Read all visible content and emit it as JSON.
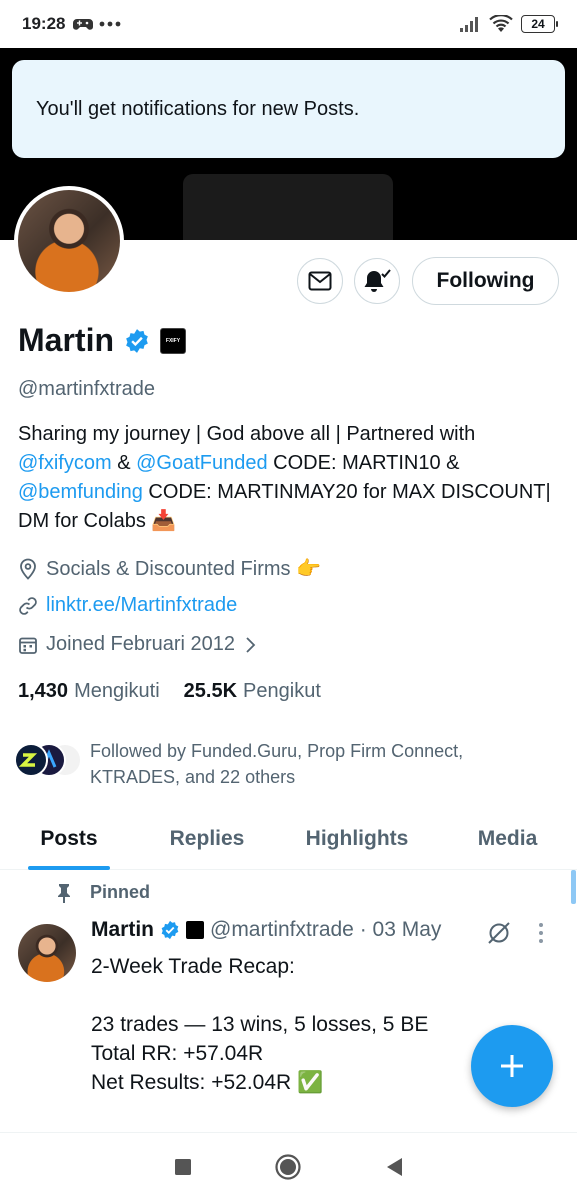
{
  "status_bar": {
    "time": "19:28",
    "battery": "24"
  },
  "toast": {
    "message": "You'll get notifications for new Posts."
  },
  "profile": {
    "name": "Martin",
    "affiliate_badge_text": "FXIFY",
    "handle": "@martinfxtrade",
    "bio": {
      "p1": "Sharing my journey | God above all | Partnered with ",
      "m1": "@fxifycom",
      "p2": " & ",
      "m2": "@GoatFunded",
      "p3": " CODE: MARTIN10 & ",
      "m3": "@bemfunding",
      "p4": " CODE: MARTINMAY20 for MAX DISCOUNT| DM for Colabs 📥"
    },
    "location": "Socials & Discounted Firms 👉",
    "website": "linktr.ee/Martinfxtrade",
    "joined": "Joined Februari 2012",
    "following_count": "1,430",
    "following_label": "Mengikuti",
    "followers_count": "25.5K",
    "followers_label": "Pengikut",
    "followed_by": "Followed by Funded.Guru, Prop Firm Connect, KTRADES, and 22 others"
  },
  "actions": {
    "follow_label": "Following"
  },
  "tabs": [
    {
      "label": "Posts",
      "active": true
    },
    {
      "label": "Replies",
      "active": false
    },
    {
      "label": "Highlights",
      "active": false
    },
    {
      "label": "Media",
      "active": false
    }
  ],
  "post": {
    "pinned_label": "Pinned",
    "author_name": "Martin",
    "handle_date": "@martinfxtrade · 03 May",
    "body": "2-Week Trade Recap:\n\n23 trades — 13 wins, 5 losses, 5 BE\nTotal RR: +57.04R\nNet Results: +52.04R ✅"
  },
  "colors": {
    "accent": "#1d9bf0",
    "text": "#0f1419",
    "muted": "#536471"
  }
}
